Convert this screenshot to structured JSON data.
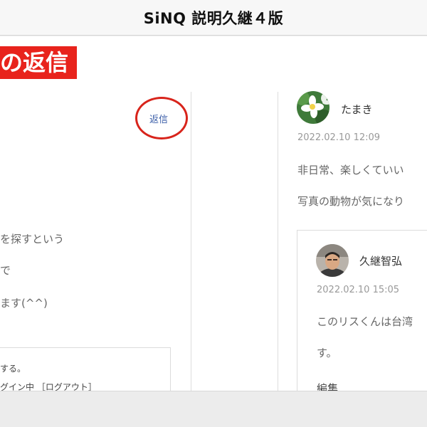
{
  "header": {
    "title": "SiNQ 説明久継４版"
  },
  "banner": {
    "heading": "の返信"
  },
  "left_comment": {
    "reply_link": "返信",
    "lines": [
      "を探すという",
      "で",
      "ます(^^)"
    ]
  },
  "login_box": {
    "lines": [
      "する。",
      "グイン中 ［ログアウト］"
    ]
  },
  "comments": [
    {
      "author": "たまき",
      "date": "2022.02.10 12:09",
      "lines": [
        "非日常、楽しくていい",
        "写真の動物が気になり"
      ]
    },
    {
      "author": "久継智弘",
      "date": "2022.02.10 15:05",
      "lines": [
        "このリスくんは台湾",
        "す。"
      ],
      "edit_link": "編集"
    }
  ]
}
